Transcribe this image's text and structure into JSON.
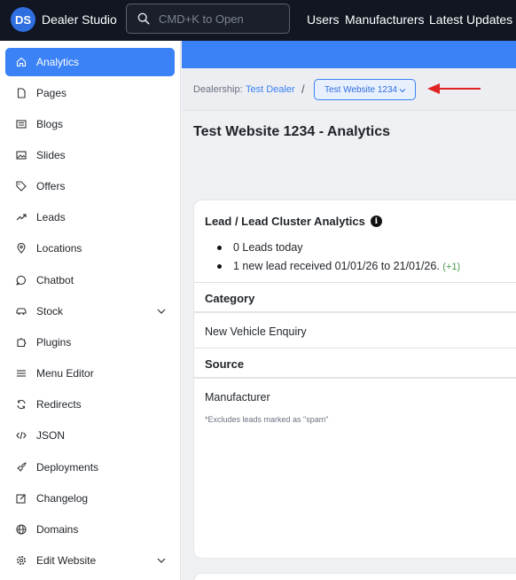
{
  "header": {
    "logo_text": "DS",
    "brand": "Dealer Studio",
    "search_placeholder": "CMD+K to Open",
    "nav": [
      "Users",
      "Manufacturers",
      "Latest Updates"
    ]
  },
  "sidebar": {
    "items": [
      {
        "label": "Analytics",
        "icon": "home-icon",
        "active": true
      },
      {
        "label": "Pages",
        "icon": "file-icon"
      },
      {
        "label": "Blogs",
        "icon": "newspaper-icon"
      },
      {
        "label": "Slides",
        "icon": "images-icon"
      },
      {
        "label": "Offers",
        "icon": "tag-icon"
      },
      {
        "label": "Leads",
        "icon": "trending-up-icon"
      },
      {
        "label": "Locations",
        "icon": "map-pin-icon"
      },
      {
        "label": "Chatbot",
        "icon": "chat-icon"
      },
      {
        "label": "Stock",
        "icon": "car-icon",
        "expandable": true
      },
      {
        "label": "Plugins",
        "icon": "puzzle-icon"
      },
      {
        "label": "Menu Editor",
        "icon": "menu-icon"
      },
      {
        "label": "Redirects",
        "icon": "refresh-icon"
      },
      {
        "label": "JSON",
        "icon": "code-icon"
      },
      {
        "label": "Deployments",
        "icon": "rocket-icon"
      },
      {
        "label": "Changelog",
        "icon": "edit-icon"
      },
      {
        "label": "Domains",
        "icon": "globe-icon"
      },
      {
        "label": "Edit Website",
        "icon": "settings-icon",
        "expandable": true
      }
    ]
  },
  "breadcrumb": {
    "label": "Dealership:",
    "dealer": "Test Dealer",
    "separator": "/",
    "website": "Test Website 1234"
  },
  "page": {
    "title": "Test Website 1234 - Analytics"
  },
  "card": {
    "title": "Lead / Lead Cluster Analytics",
    "bullet_1": "0 Leads today",
    "bullet_2": "1 new lead received 01/01/26 to 21/01/26.",
    "bullet_2_delta": "(+1)",
    "category_heading": "Category",
    "category_value": "New Vehicle Enquiry",
    "source_heading": "Source",
    "source_value": "Manufacturer",
    "footnote": "*Excludes leads marked as \"spam\""
  },
  "colors": {
    "topbar": "#111622",
    "accent": "#3b82f6",
    "annotation_arrow": "#e02424",
    "delta_green": "#4a9a4a"
  }
}
